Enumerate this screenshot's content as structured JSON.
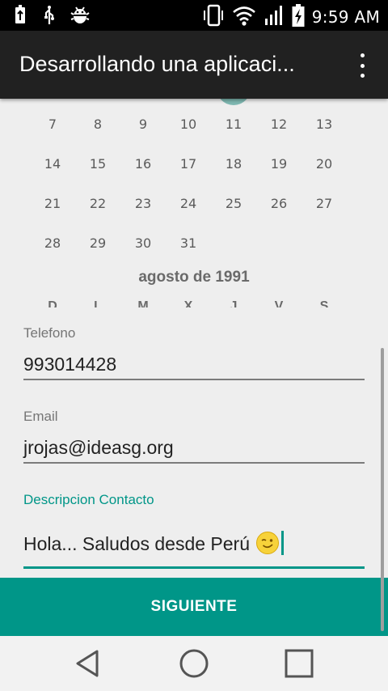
{
  "status_bar": {
    "time": "9:59 AM",
    "icons": [
      "usb-icon",
      "usb-debug-icon",
      "android-debug-icon",
      "vibrate-icon",
      "wifi-icon",
      "signal-icon",
      "battery-charging-icon"
    ]
  },
  "toolbar": {
    "title": "Desarrollando una aplicaci...",
    "overflow_icon": "more-vert-icon"
  },
  "calendar": {
    "weeks": [
      [
        "7",
        "8",
        "9",
        "10",
        "11",
        "12",
        "13"
      ],
      [
        "14",
        "15",
        "16",
        "17",
        "18",
        "19",
        "20"
      ],
      [
        "21",
        "22",
        "23",
        "24",
        "25",
        "26",
        "27"
      ],
      [
        "28",
        "29",
        "30",
        "31",
        "",
        "",
        ""
      ]
    ],
    "next_month_label": "agosto de 1991",
    "weekday_headers": [
      "D",
      "L",
      "M",
      "X",
      "J",
      "V",
      "S"
    ],
    "accent_color": "#7fb8b2"
  },
  "form": {
    "phone": {
      "label": "Telefono",
      "value": "993014428"
    },
    "email": {
      "label": "Email",
      "value": "jrojas@ideasg.org"
    },
    "description": {
      "label": "Descripcion Contacto",
      "value": "Hola... Saludos desde Perú"
    },
    "accent_color": "#009688"
  },
  "next_button": {
    "label": "SIGUIENTE"
  },
  "nav_bar": {
    "back_icon": "back-triangle-icon",
    "home_icon": "home-circle-icon",
    "recents_icon": "recents-square-icon"
  }
}
